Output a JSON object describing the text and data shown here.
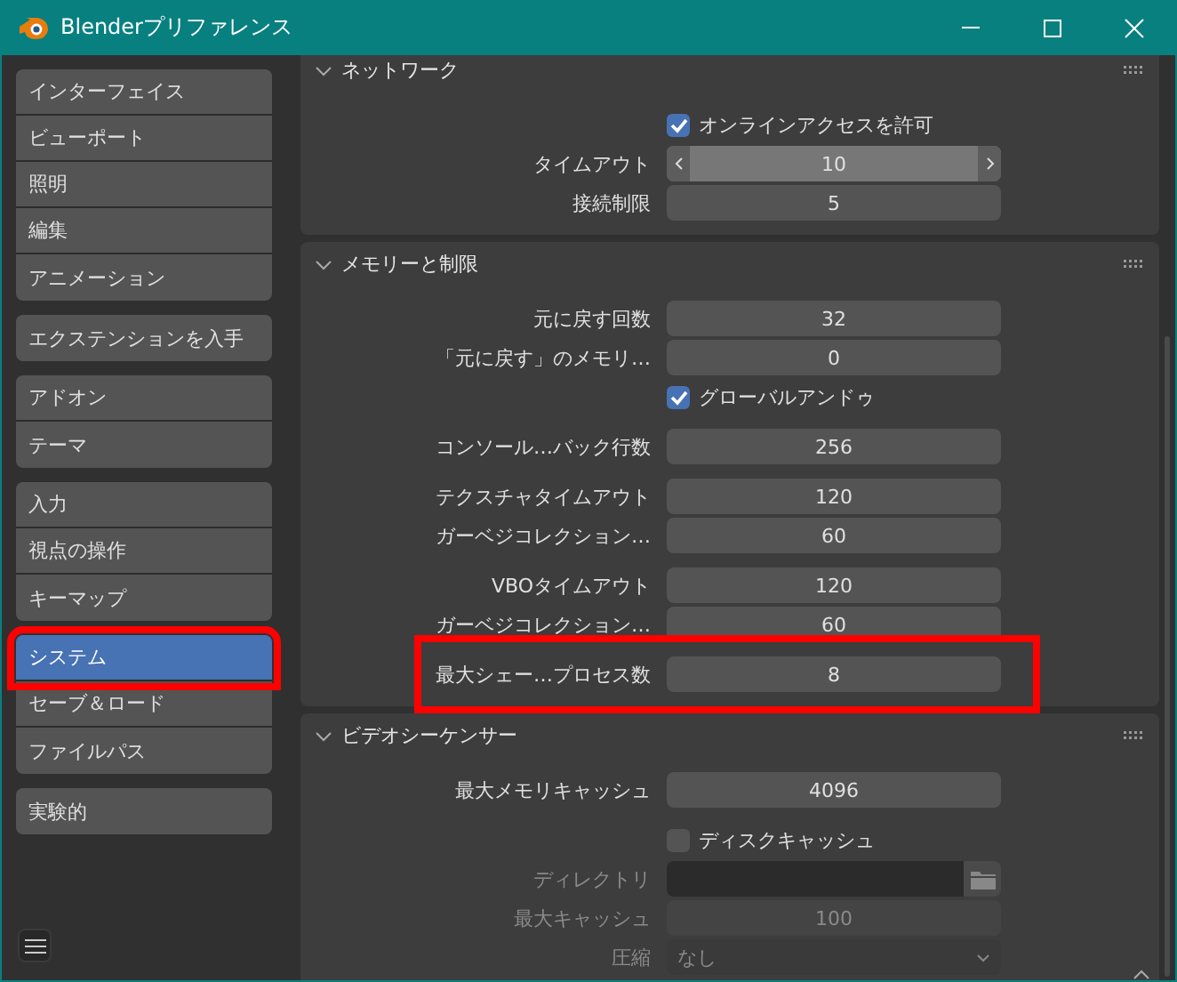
{
  "window": {
    "title": "Blenderプリファレンス"
  },
  "sidebar": {
    "groups": [
      [
        {
          "label": "インターフェイス",
          "selected": false,
          "highlighted": false
        },
        {
          "label": "ビューポート",
          "selected": false,
          "highlighted": false
        },
        {
          "label": "照明",
          "selected": false,
          "highlighted": false
        },
        {
          "label": "編集",
          "selected": false,
          "highlighted": false
        },
        {
          "label": "アニメーション",
          "selected": false,
          "highlighted": false
        }
      ],
      [
        {
          "label": "エクステンションを入手",
          "selected": false,
          "highlighted": false
        }
      ],
      [
        {
          "label": "アドオン",
          "selected": false,
          "highlighted": false
        },
        {
          "label": "テーマ",
          "selected": false,
          "highlighted": false
        }
      ],
      [
        {
          "label": "入力",
          "selected": false,
          "highlighted": false
        },
        {
          "label": "視点の操作",
          "selected": false,
          "highlighted": false
        },
        {
          "label": "キーマップ",
          "selected": false,
          "highlighted": false
        }
      ],
      [
        {
          "label": "システム",
          "selected": true,
          "highlighted": true
        },
        {
          "label": "セーブ＆ロード",
          "selected": false,
          "highlighted": false
        },
        {
          "label": "ファイルパス",
          "selected": false,
          "highlighted": false
        }
      ],
      [
        {
          "label": "実験的",
          "selected": false,
          "highlighted": false
        }
      ]
    ]
  },
  "panels": [
    {
      "title": "ネットワーク",
      "expanded": true,
      "groups": [
        [
          {
            "kind": "checkbox",
            "label": "オンラインアクセスを許可",
            "checked": true,
            "disabled": false
          },
          {
            "kind": "stepper",
            "label": "タイムアウト",
            "value": "10",
            "disabled": false
          },
          {
            "kind": "number",
            "label": "接続制限",
            "value": "5",
            "disabled": false
          }
        ]
      ]
    },
    {
      "title": "メモリーと制限",
      "expanded": true,
      "groups": [
        [
          {
            "kind": "number",
            "label": "元に戻す回数",
            "value": "32",
            "disabled": false
          },
          {
            "kind": "number",
            "label": "「元に戻す」のメモリ…",
            "value": "0",
            "disabled": false
          },
          {
            "kind": "checkbox",
            "label": "グローバルアンドゥ",
            "checked": true,
            "disabled": false
          }
        ],
        [
          {
            "kind": "number",
            "label": "コンソール…バック行数",
            "value": "256",
            "disabled": false
          }
        ],
        [
          {
            "kind": "number",
            "label": "テクスチャタイムアウト",
            "value": "120",
            "disabled": false
          },
          {
            "kind": "number",
            "label": "ガーベジコレクション…",
            "value": "60",
            "disabled": false
          }
        ],
        [
          {
            "kind": "number",
            "label": "VBOタイムアウト",
            "value": "120",
            "disabled": false
          },
          {
            "kind": "number",
            "label": "ガーベジコレクション…",
            "value": "60",
            "disabled": false
          }
        ],
        [
          {
            "kind": "number",
            "label": "最大シェー…プロセス数",
            "value": "8",
            "disabled": false,
            "highlighted": true
          }
        ]
      ]
    },
    {
      "title": "ビデオシーケンサー",
      "expanded": true,
      "groups": [
        [
          {
            "kind": "number",
            "label": "最大メモリキャッシュ",
            "value": "4096",
            "disabled": false
          }
        ],
        [
          {
            "kind": "checkbox",
            "label": "ディスクキャッシュ",
            "checked": false,
            "disabled": false
          },
          {
            "kind": "path",
            "label": "ディレクトリ",
            "disabled": true
          },
          {
            "kind": "number",
            "label": "最大キャッシュ",
            "value": "100",
            "disabled": true
          },
          {
            "kind": "dropdown",
            "label": "圧縮",
            "value": "なし",
            "disabled": true
          }
        ]
      ]
    }
  ]
}
